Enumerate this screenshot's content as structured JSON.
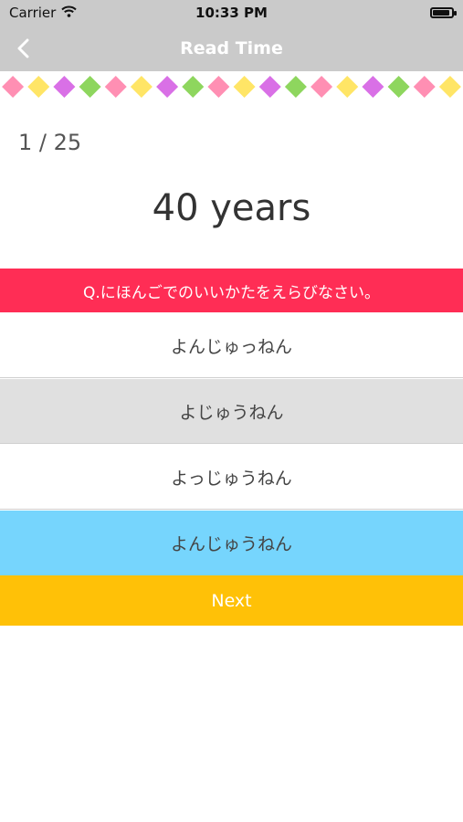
{
  "status_bar": {
    "carrier": "Carrier",
    "time": "10:33 PM",
    "battery_level": 0.9
  },
  "nav": {
    "title": "Read Time",
    "back_icon": "chevron-left-icon"
  },
  "banner": {
    "colors": [
      "#ff8fb3",
      "#ffe566",
      "#d970e6",
      "#8ed65e"
    ],
    "count": 18
  },
  "quiz": {
    "counter": "1 / 25",
    "word": "40 years",
    "question": "Q.にほんごでのいいかたをえらびなさい。",
    "options": [
      {
        "label": "よんじゅっねん",
        "bg": "#ffffff"
      },
      {
        "label": "よじゅうねん",
        "bg": "#e0e0e0"
      },
      {
        "label": "よっじゅうねん",
        "bg": "#ffffff"
      },
      {
        "label": "よんじゅうねん",
        "bg": "#76d5fd"
      }
    ],
    "next_label": "Next"
  }
}
